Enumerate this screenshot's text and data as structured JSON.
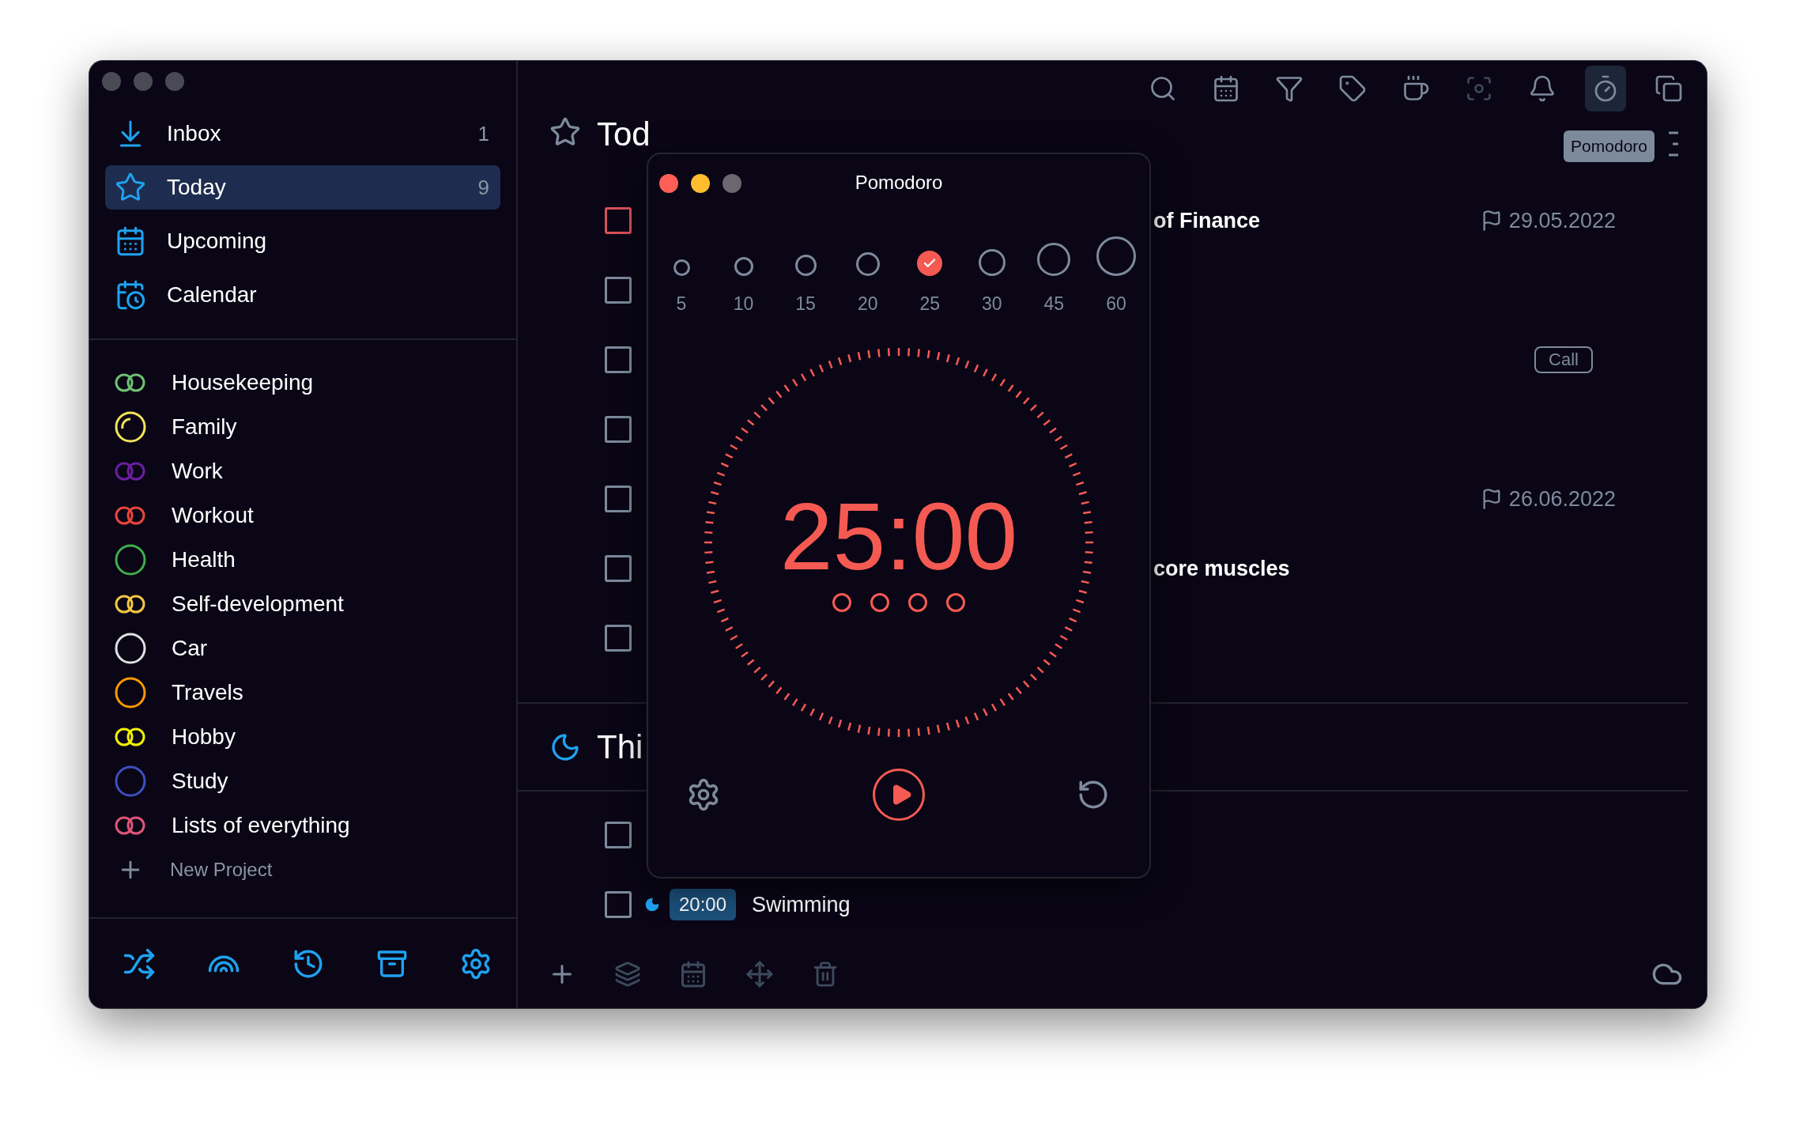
{
  "sidebar": {
    "nav": [
      {
        "label": "Inbox",
        "count": "1",
        "selected": false
      },
      {
        "label": "Today",
        "count": "9",
        "selected": true
      },
      {
        "label": "Upcoming",
        "selected": false
      },
      {
        "label": "Calendar",
        "selected": false
      }
    ],
    "projects": [
      {
        "label": "Housekeeping",
        "kind": "double",
        "color": "#6fbf73"
      },
      {
        "label": "Family",
        "kind": "arc",
        "color": "#f5e35b"
      },
      {
        "label": "Work",
        "kind": "double",
        "color": "#6a1fa0"
      },
      {
        "label": "Workout",
        "kind": "double",
        "color": "#e8453c"
      },
      {
        "label": "Health",
        "kind": "single",
        "color": "#3fae49"
      },
      {
        "label": "Self-development",
        "kind": "double",
        "color": "#f4c542"
      },
      {
        "label": "Car",
        "kind": "single",
        "color": "#e0e0e0"
      },
      {
        "label": "Travels",
        "kind": "single",
        "color": "#ff9800"
      },
      {
        "label": "Hobby",
        "kind": "double",
        "color": "#f0f000"
      },
      {
        "label": "Study",
        "kind": "single",
        "color": "#3f4fc0"
      },
      {
        "label": "Lists of everything",
        "kind": "double",
        "color": "#e0547a"
      }
    ],
    "new_project": "New Project"
  },
  "toolbar": {
    "tooltip": "Pomodoro"
  },
  "main": {
    "heading": "Tod",
    "tasks": [
      {
        "kind": "clipped",
        "color": "#d9505a",
        "title": "of Finance",
        "date": "29.05.2022"
      },
      {
        "kind": "clipped",
        "color": "#7d8a9b"
      },
      {
        "kind": "clipped",
        "color": "#7d8a9b",
        "tag": "Call"
      },
      {
        "kind": "clipped",
        "color": "#7d8a9b"
      },
      {
        "kind": "clipped",
        "color": "#7d8a9b",
        "date": "26.06.2022"
      },
      {
        "kind": "clipped",
        "color": "#7d8a9b",
        "title": "core muscles"
      },
      {
        "kind": "clipped",
        "color": "#7d8a9b"
      }
    ],
    "section": {
      "heading": "Thi",
      "tasks": [
        {
          "kind": "clipped",
          "color": "#7d8a9b"
        },
        {
          "kind": "timed",
          "color": "#7d8a9b",
          "time": "20:00",
          "title": "Swimming"
        }
      ]
    }
  },
  "pomodoro": {
    "title": "Pomodoro",
    "durations": [
      {
        "label": "5",
        "selected": false
      },
      {
        "label": "10",
        "selected": false
      },
      {
        "label": "15",
        "selected": false
      },
      {
        "label": "20",
        "selected": false
      },
      {
        "label": "25",
        "selected": true
      },
      {
        "label": "30",
        "selected": false
      },
      {
        "label": "45",
        "selected": false
      },
      {
        "label": "60",
        "selected": false
      }
    ],
    "time": "25:00"
  }
}
